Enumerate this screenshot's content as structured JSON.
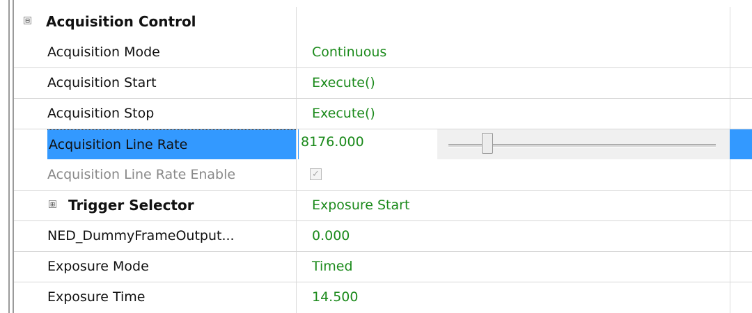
{
  "category": {
    "title": "Acquisition Control",
    "expander": "⊟"
  },
  "rows": [
    {
      "name": "Acquisition Mode",
      "value": "Continuous"
    },
    {
      "name": "Acquisition Start",
      "value": "Execute()"
    },
    {
      "name": "Acquisition Stop",
      "value": "Execute()"
    },
    {
      "name": "Acquisition Line Rate",
      "value": "8176.000"
    },
    {
      "name": "Acquisition Line Rate Enable",
      "checked_glyph": "✓"
    },
    {
      "name": "Trigger Selector",
      "value": "Exposure Start",
      "expander": "⊞"
    },
    {
      "name": "NED_DummyFrameOutput...",
      "value": "0.000"
    },
    {
      "name": "Exposure Mode",
      "value": "Timed"
    },
    {
      "name": "Exposure Time",
      "value": "14.500"
    }
  ],
  "slider": {
    "level": 0.13
  },
  "colors": {
    "value_text": "#1b8a1b",
    "selection": "#3399ff",
    "disabled_text": "#888888"
  }
}
